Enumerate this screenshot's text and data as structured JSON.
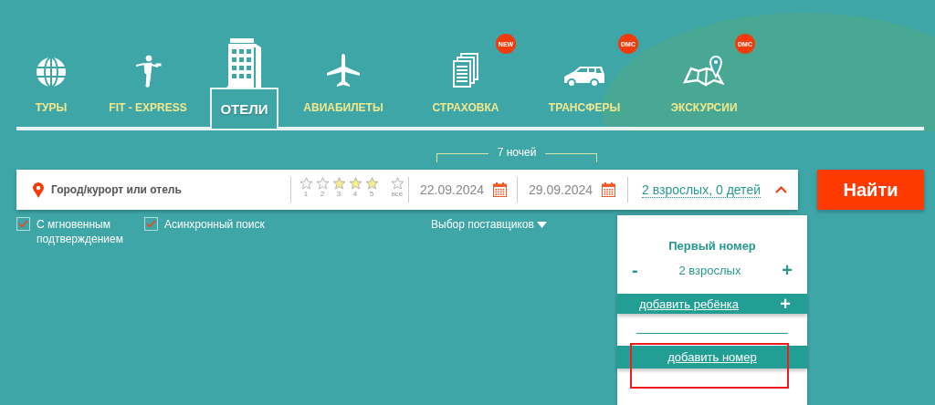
{
  "tabs": [
    {
      "label": "ТУРЫ",
      "selected": false
    },
    {
      "label": "FIT - EXPRESS",
      "selected": false
    },
    {
      "label": "ОТЕЛИ",
      "selected": true
    },
    {
      "label": "АВИАБИЛЕТЫ",
      "selected": false
    },
    {
      "label": "СТРАХОВКА",
      "selected": false,
      "badge": "NEW"
    },
    {
      "label": "ТРАНСФЕРЫ",
      "selected": false,
      "badge": "DMC"
    },
    {
      "label": "ЭКСКУРСИИ",
      "selected": false,
      "badge": "DMC"
    }
  ],
  "nights": "7 ночей",
  "search": {
    "destination": {
      "placeholder": "Город/курорт или отель"
    },
    "star_filters": [
      {
        "label": "1",
        "selected": false
      },
      {
        "label": "2",
        "selected": false
      },
      {
        "label": "3",
        "selected": true
      },
      {
        "label": "4",
        "selected": true
      },
      {
        "label": "5",
        "selected": true
      },
      {
        "label": "все",
        "selected": false
      }
    ],
    "check_in": "22.09.2024",
    "check_out": "29.09.2024",
    "guests": "2 взрослых, 0 детей",
    "expanded": true,
    "button": "Найти"
  },
  "options": [
    {
      "label": "С мгновенным подтверждением",
      "checked": true
    },
    {
      "label": "Асинхронный поиск",
      "checked": true
    }
  ],
  "suppliers": "Выбор поставщиков",
  "rooms_panel": {
    "title": "Первый номер",
    "minus": "-",
    "adults": "2 взрослых",
    "plus": "+",
    "add_child": "добавить ребёнка",
    "add_child_plus": "+",
    "add_room": "добавить номер",
    "add_room_highlighted": true
  }
}
